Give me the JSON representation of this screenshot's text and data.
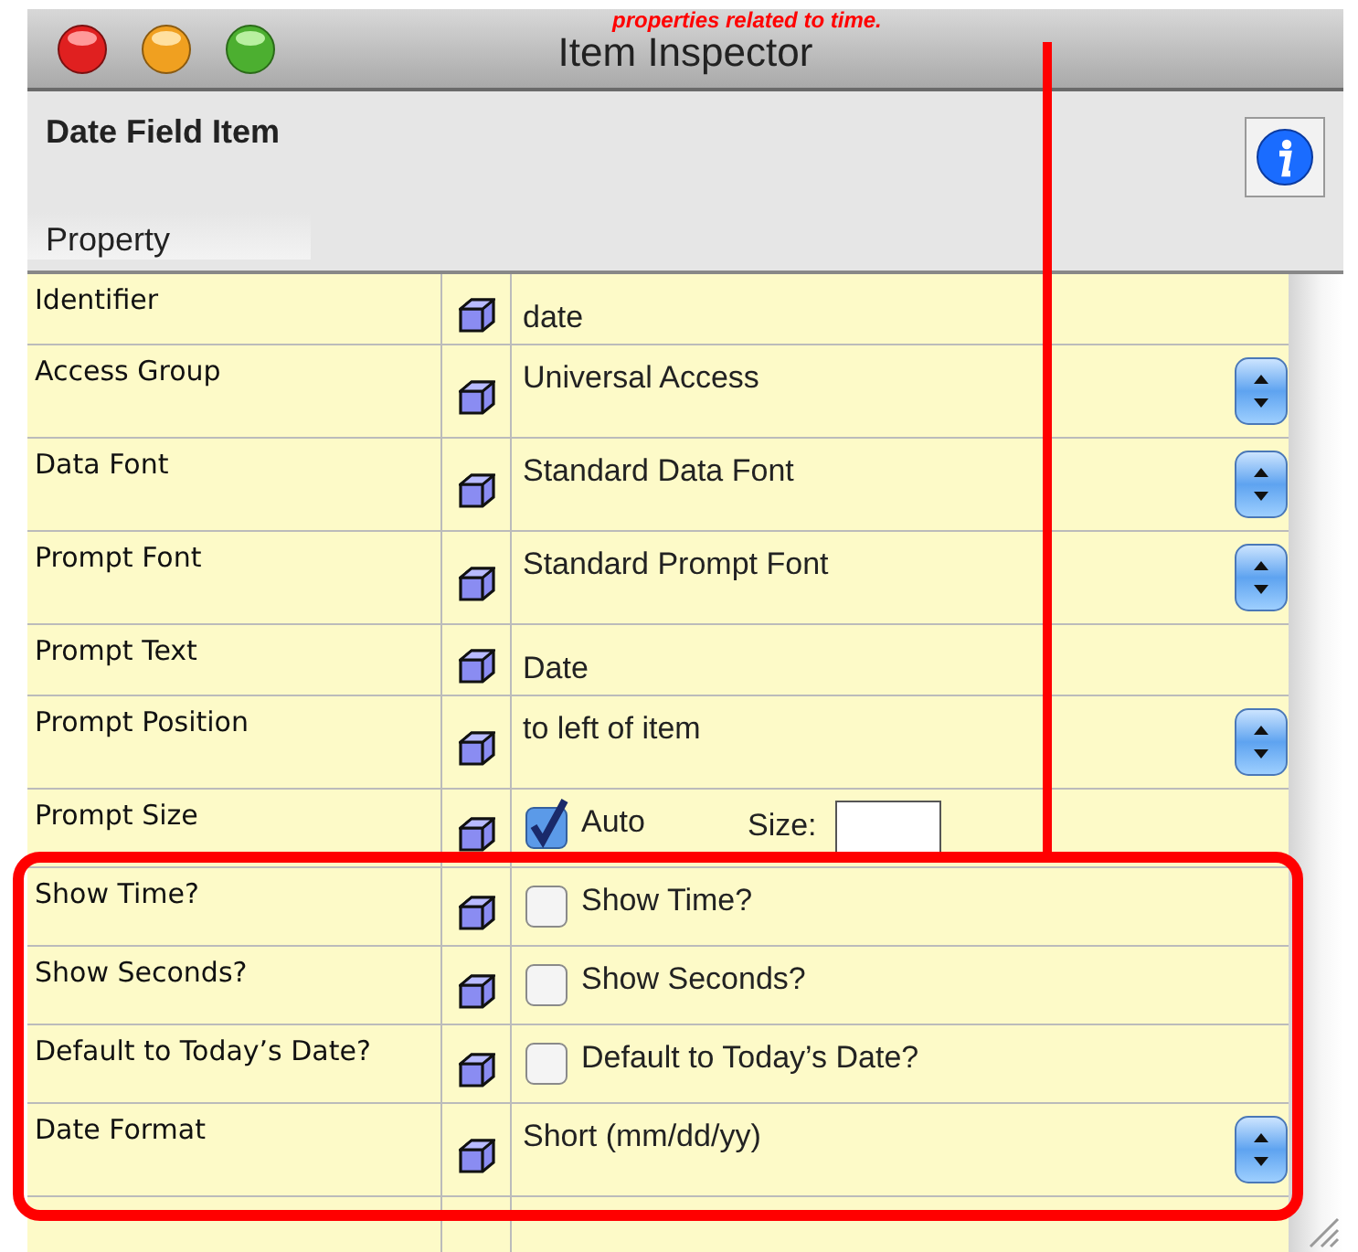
{
  "annotation": {
    "text": "properties  related to time."
  },
  "window": {
    "title": "Item Inspector"
  },
  "header": {
    "item_type": "Date Field Item",
    "column_header": "Property"
  },
  "rows": [
    {
      "name": "Identifier",
      "kind": "text",
      "value": "date"
    },
    {
      "name": "Access Group",
      "kind": "popup",
      "value": "Universal Access"
    },
    {
      "name": "Data Font",
      "kind": "popup",
      "value": "Standard Data Font"
    },
    {
      "name": "Prompt Font",
      "kind": "popup",
      "value": "Standard Prompt Font"
    },
    {
      "name": "Prompt Text",
      "kind": "text",
      "value": "Date"
    },
    {
      "name": "Prompt Position",
      "kind": "popup",
      "value": "to left of item"
    },
    {
      "name": "Prompt Size",
      "kind": "size",
      "checked": true,
      "label": "Auto",
      "size_label": "Size:"
    },
    {
      "name": "Show Time?",
      "kind": "checkbox",
      "checked": false,
      "label": "Show Time?"
    },
    {
      "name": "Show Seconds?",
      "kind": "checkbox",
      "checked": false,
      "label": "Show Seconds?"
    },
    {
      "name": "Default to Today’s Date?",
      "kind": "checkbox",
      "checked": false,
      "label": "Default to Today’s Date?"
    },
    {
      "name": "Date Format",
      "kind": "popup",
      "value": "Short (mm/dd/yy)"
    }
  ]
}
